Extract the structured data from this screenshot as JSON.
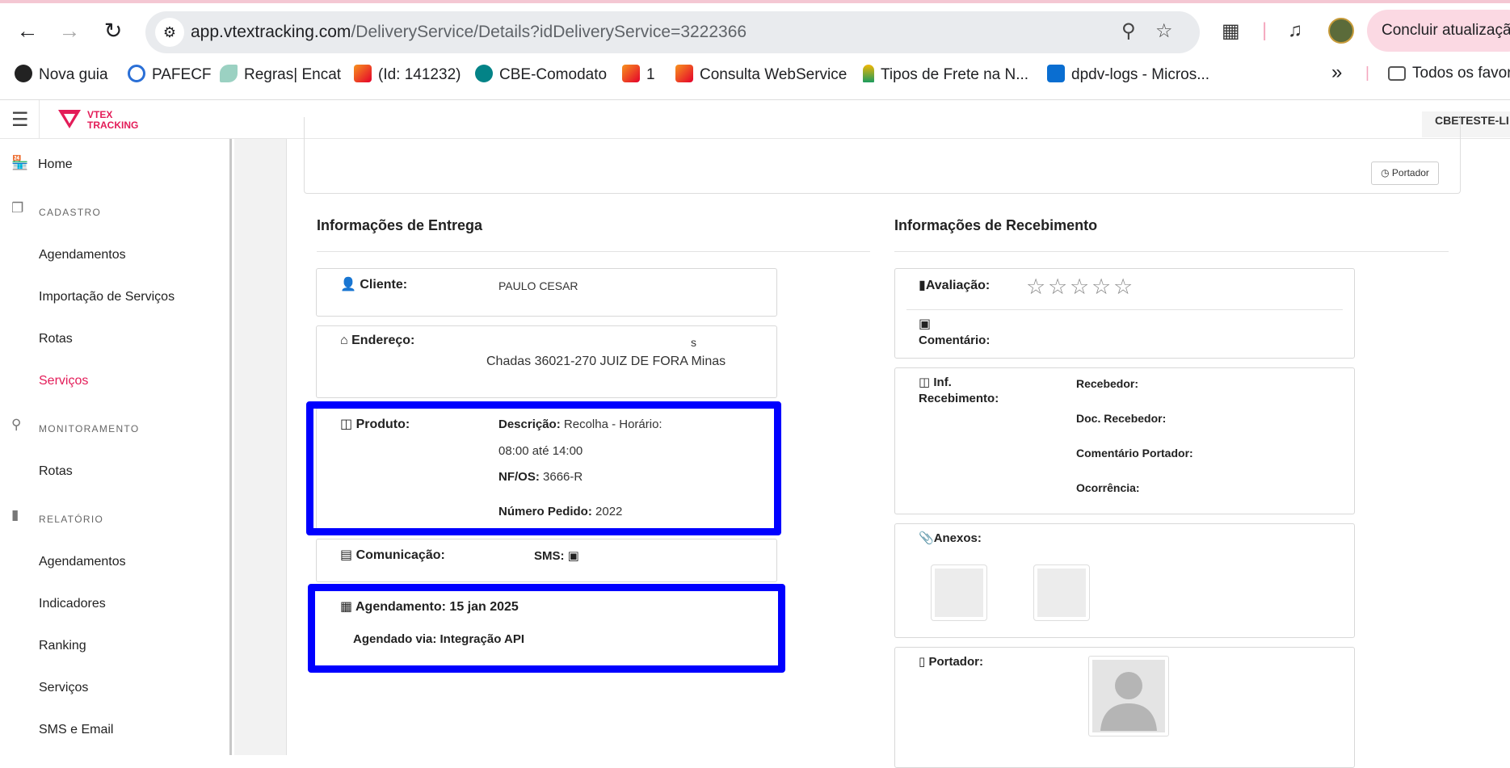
{
  "browser": {
    "url_host": "app.vtextracking.com",
    "url_path": "/DeliveryService/Details?idDeliveryService=3222366",
    "update_button": "Concluir atualização",
    "bookmarks": [
      {
        "label": "Nova guia",
        "icon": "globe-icon"
      },
      {
        "label": "PAFECF",
        "icon": "bookmark-icon"
      },
      {
        "label": "Regras| Encat",
        "icon": "bookmark-icon"
      },
      {
        "label": "(Id: 141232)",
        "icon": "bookmark-icon"
      },
      {
        "label": "CBE-Comodato",
        "icon": "sharepoint-icon"
      },
      {
        "label": "1",
        "icon": "bookmark-icon"
      },
      {
        "label": "Consulta WebService",
        "icon": "bookmark-icon"
      },
      {
        "label": "Tipos de Frete na N...",
        "icon": "bookmark-icon"
      },
      {
        "label": "dpdv-logs - Micros...",
        "icon": "azure-icon"
      }
    ],
    "bookmarks_overflow": "»",
    "all_bookmarks": "Todos os favoritos"
  },
  "app": {
    "logo_line1": "VTEX",
    "logo_line2": "TRACKING",
    "account": "CBETESTE-LI"
  },
  "sidebar": {
    "home": "Home",
    "cadastro_section": "CADASTRO",
    "cadastro_items": [
      "Agendamentos",
      "Importação de Serviços",
      "Rotas",
      "Serviços"
    ],
    "monitoramento_section": "MONITORAMENTO",
    "monitoramento_items": [
      "Rotas"
    ],
    "relatorio_section": "RELATÓRIO",
    "relatorio_items": [
      "Agendamentos",
      "Indicadores",
      "Ranking",
      "Serviços",
      "SMS e Email"
    ],
    "active_color": "#e31c58"
  },
  "top_card": {
    "portador_button": "Portador"
  },
  "entrega": {
    "title": "Informações de Entrega",
    "cliente_label": "Cliente:",
    "cliente_value": "PAULO CESAR",
    "endereco_label": "Endereço:",
    "endereco_line1": "s",
    "endereco_line2": "Chadas 36021-270 JUIZ DE FORA Minas",
    "produto_label": "Produto:",
    "descricao_label": "Descrição:",
    "descricao_value": "Recolha - Horário:",
    "descricao_value2": "08:00 até 14:00",
    "nfos_label": "NF/OS:",
    "nfos_value": "3666-R",
    "pedido_label": "Número Pedido:",
    "pedido_value": "2022",
    "comunicacao_label": "Comunicação:",
    "sms_label": "SMS:",
    "agendamento_label": "Agendamento: 15 jan 2025",
    "agendado_via": "Agendado via: Integração API"
  },
  "recebimento": {
    "title": "Informações de Recebimento",
    "avaliacao_label": "Avaliação:",
    "stars": 0,
    "comentario_label": "Comentário:",
    "inf_label_line1": "Inf.",
    "inf_label_line2": "Recebimento:",
    "recebedor": "Recebedor:",
    "doc_recebedor": "Doc. Recebedor:",
    "comentario_portador": "Comentário Portador:",
    "ocorrencia": "Ocorrência:",
    "anexos_label": "Anexos:",
    "portador_label": "Portador:"
  },
  "colors": {
    "highlight": "#0000ff",
    "brand": "#e31c58"
  }
}
